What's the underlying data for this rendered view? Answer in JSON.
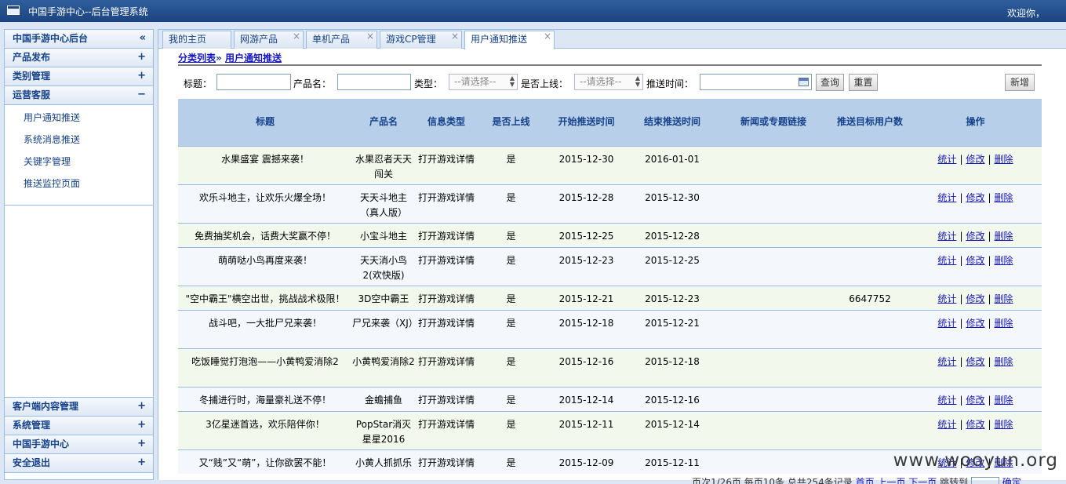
{
  "header": {
    "title": "中国手游中心--后台管理系统",
    "welcome": "欢迎你，"
  },
  "sidebar": {
    "title": "中国手游中心后台",
    "collapse_symbol": "«",
    "sections": [
      {
        "label": "产品发布",
        "sym": "+"
      },
      {
        "label": "类别管理",
        "sym": "+"
      },
      {
        "label": "运营客服",
        "sym": "−"
      }
    ],
    "sub_items": [
      "用户通知推送",
      "系统消息推送",
      "关键字管理",
      "推送监控页面"
    ],
    "bottom_sections": [
      {
        "label": "客户端内容管理",
        "sym": "+"
      },
      {
        "label": "系统管理",
        "sym": "+"
      },
      {
        "label": "中国手游中心",
        "sym": "+"
      },
      {
        "label": "安全退出",
        "sym": "+"
      }
    ]
  },
  "tabs": [
    {
      "label": "我的主页",
      "closable": false
    },
    {
      "label": "网游产品",
      "closable": true
    },
    {
      "label": "单机产品",
      "closable": true
    },
    {
      "label": "游戏CP管理",
      "closable": true
    },
    {
      "label": "用户通知推送",
      "closable": true,
      "active": true
    }
  ],
  "close_symbol": "×",
  "breadcrumb": {
    "parent": "分类列表",
    "sep": "»",
    "current": "用户通知推送"
  },
  "search": {
    "title_label": "标题：",
    "product_label": "产品名：",
    "type_label": "类型：",
    "type_value": "--请选择--",
    "online_label": "是否上线：",
    "online_value": "--请选择--",
    "time_label": "推送时间：",
    "query_btn": "查询",
    "reset_btn": "重置",
    "add_btn": "新增"
  },
  "table": {
    "headers": [
      "标题",
      "产品名",
      "信息类型",
      "是否上线",
      "开始推送时间",
      "结束推送时间",
      "新闻或专题链接",
      "推送目标用户数",
      "操作"
    ],
    "actions": [
      "统计",
      "修改",
      "删除"
    ],
    "rows": [
      {
        "title": "水果盛宴 震撼来袭！",
        "product": "水果忍者天天闯关",
        "type": "打开游戏详情",
        "online": "是",
        "start": "2015-12-30",
        "end": "2016-01-01",
        "link": "",
        "target": ""
      },
      {
        "title": "欢乐斗地主，让欢乐火爆全场！",
        "product": "天天斗地主（真人版）",
        "type": "打开游戏详情",
        "online": "是",
        "start": "2015-12-28",
        "end": "2015-12-30",
        "link": "",
        "target": ""
      },
      {
        "title": "免费抽奖机会，话费大奖赢不停！",
        "product": "小宝斗地主",
        "type": "打开游戏详情",
        "online": "是",
        "start": "2015-12-25",
        "end": "2015-12-28",
        "link": "",
        "target": ""
      },
      {
        "title": "萌萌哒小鸟再度来袭！",
        "product": "天天消小鸟2(欢快版)",
        "type": "打开游戏详情",
        "online": "是",
        "start": "2015-12-23",
        "end": "2015-12-25",
        "link": "",
        "target": ""
      },
      {
        "title": "\"空中霸王\"横空出世，挑战战术极限！",
        "product": "3D空中霸王",
        "type": "打开游戏详情",
        "online": "是",
        "start": "2015-12-21",
        "end": "2015-12-23",
        "link": "",
        "target": "6647752"
      },
      {
        "title": "战斗吧，一大批尸兄来袭！",
        "product": "尸兄来袭（XJ）",
        "type": "打开游戏详情",
        "online": "是",
        "start": "2015-12-18",
        "end": "2015-12-21",
        "link": "",
        "target": ""
      },
      {
        "title": "吃饭睡觉打泡泡——小黄鸭爱消除2",
        "product": "小黄鸭爱消除2",
        "type": "打开游戏详情",
        "online": "是",
        "start": "2015-12-16",
        "end": "2015-12-18",
        "link": "",
        "target": ""
      },
      {
        "title": "冬捕进行时，海量豪礼送不停！",
        "product": "金蟾捕鱼",
        "type": "打开游戏详情",
        "online": "是",
        "start": "2015-12-14",
        "end": "2015-12-16",
        "link": "",
        "target": ""
      },
      {
        "title": "3亿星迷首选，欢乐陪伴你！",
        "product": "PopStar消灭星星2016",
        "type": "打开游戏详情",
        "online": "是",
        "start": "2015-12-11",
        "end": "2015-12-14",
        "link": "",
        "target": ""
      },
      {
        "title": "又“贱”又“萌”，让你欲罢不能！",
        "product": "小黄人抓抓乐",
        "type": "打开游戏详情",
        "online": "是",
        "start": "2015-12-09",
        "end": "2015-12-11",
        "link": "",
        "target": ""
      }
    ]
  },
  "pager": {
    "text": "页次1/26页 每页10条 总共254条记录",
    "first": "首页",
    "prev": "上一页",
    "next": "下一页",
    "jump": "跳转到",
    "go": "确定"
  },
  "watermark": "www.wooyun.org"
}
